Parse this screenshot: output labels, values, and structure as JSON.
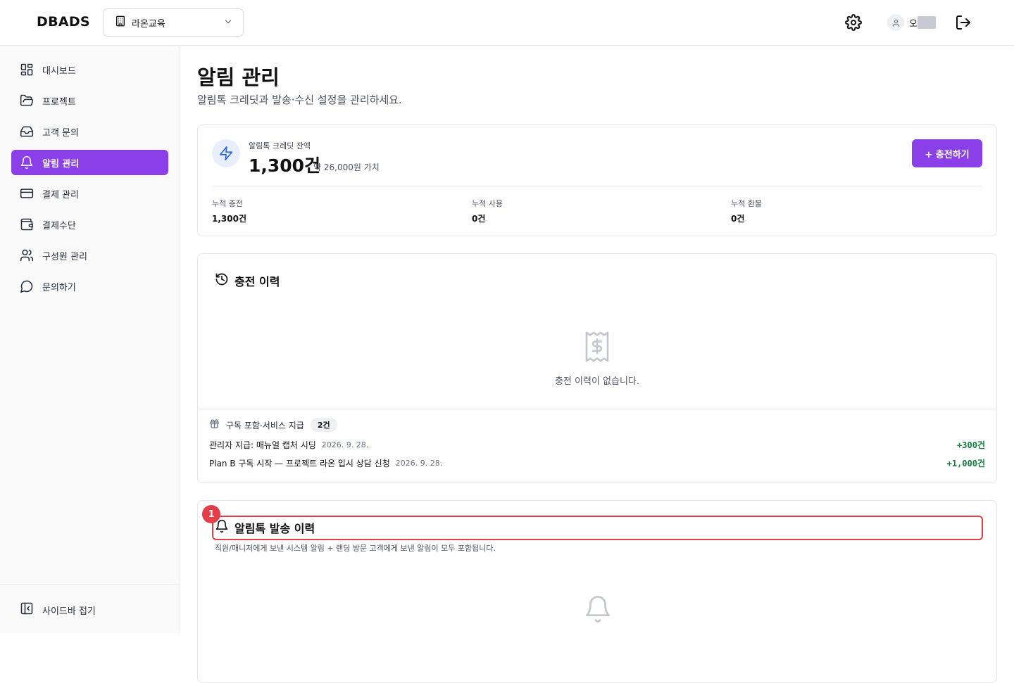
{
  "app": {
    "logo": "DBADS"
  },
  "header": {
    "org_select": {
      "value": "라온교육"
    },
    "user": {
      "name": "오"
    }
  },
  "sidebar": {
    "items": [
      {
        "label": "대시보드",
        "icon": "dashboard-icon"
      },
      {
        "label": "프로젝트",
        "icon": "folder-icon"
      },
      {
        "label": "고객 문의",
        "icon": "inbox-icon"
      },
      {
        "label": "알림 관리",
        "icon": "bell-icon",
        "active": true
      },
      {
        "label": "결제 관리",
        "icon": "credit-card-icon"
      },
      {
        "label": "결제수단",
        "icon": "wallet-icon"
      },
      {
        "label": "구성원 관리",
        "icon": "users-icon"
      },
      {
        "label": "문의하기",
        "icon": "message-circle-icon"
      }
    ],
    "collapse_label": "사이드바 접기"
  },
  "page": {
    "title": "알림 관리",
    "subtitle": "알림톡 크레딧과 발송·수신 설정을 관리하세요."
  },
  "credit": {
    "label": "알림톡 크레딧 잔액",
    "amount": "1,300건",
    "value_note": "약 26,000원 가치",
    "charge_button": "+ 충전하기",
    "stats": [
      {
        "label": "누적 충전",
        "value": "1,300건"
      },
      {
        "label": "누적 사용",
        "value": "0건"
      },
      {
        "label": "누적 환불",
        "value": "0건"
      }
    ]
  },
  "charge_history": {
    "title": "충전 이력",
    "empty_text": "충전 이력이 없습니다.",
    "grants": {
      "title": "구독 포함·서비스 지급",
      "count": "2건",
      "rows": [
        {
          "desc": "관리자 지급: 매뉴얼 캡처 시딩",
          "date": "2026. 9. 28.",
          "amount": "+300건"
        },
        {
          "desc": "Plan B 구독 시작 — 프로젝트 라온 입시 상담 신청",
          "date": "2026. 9. 28.",
          "amount": "+1,000건"
        }
      ]
    }
  },
  "send_history": {
    "title": "알림톡 발송 이력",
    "subtitle": "직원/매니저에게 보낸 시스템 알림 + 랜딩 방문 고객에게 보낸 알림이 모두 포함됩니다.",
    "marker": "1"
  },
  "colors": {
    "accent": "#8b3fe9",
    "positive": "#15803d",
    "highlight": "#e53e49"
  }
}
